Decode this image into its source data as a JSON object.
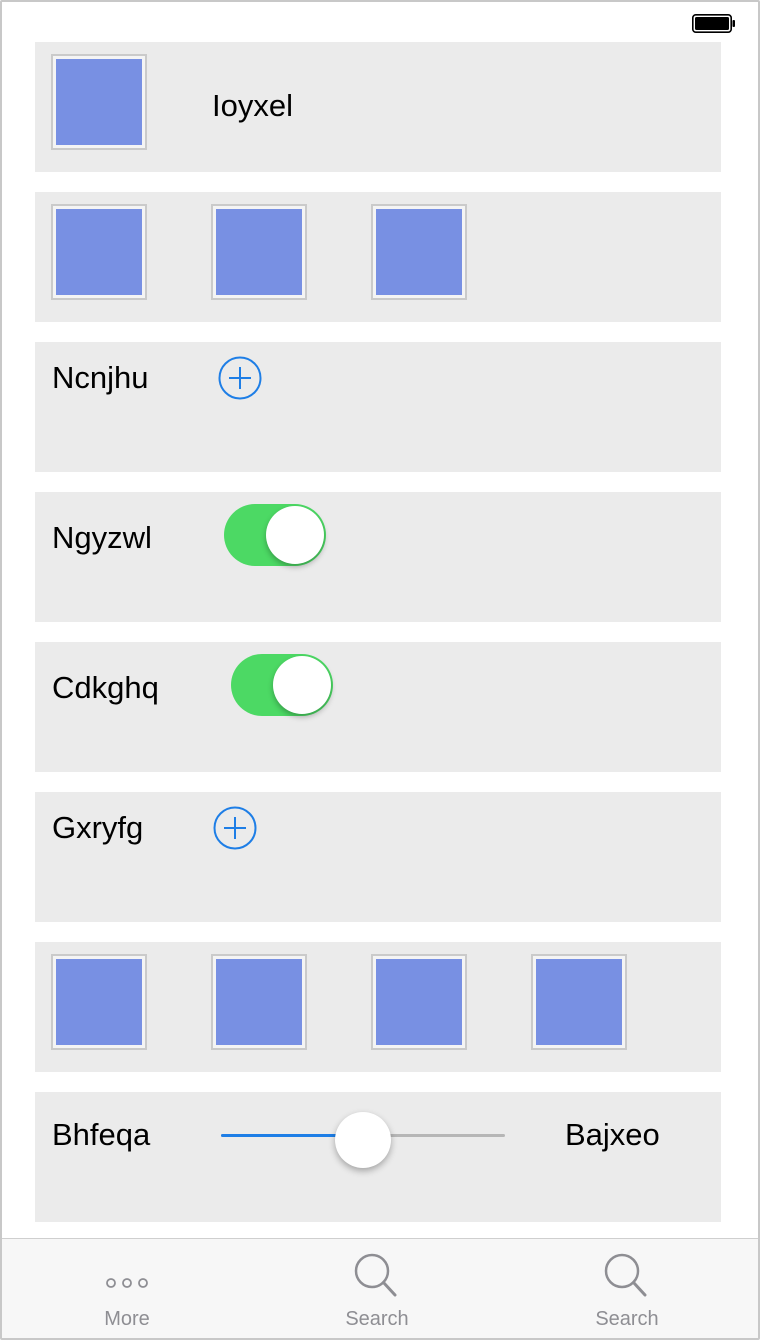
{
  "status_bar": {
    "battery": "full"
  },
  "rows": {
    "row1": {
      "label": "Ioyxel"
    },
    "row3": {
      "label": "Ncnjhu"
    },
    "row4": {
      "label": "Ngyzwl",
      "toggle_on": true
    },
    "row5": {
      "label": "Cdkghq",
      "toggle_on": true
    },
    "row6": {
      "label": "Gxryfg"
    },
    "row8": {
      "min_label": "Bhfeqa",
      "max_label": "Bajxeo",
      "value_fraction": 0.5
    }
  },
  "tabbar": {
    "tabs": [
      {
        "label": "More",
        "icon": "more-dots-icon"
      },
      {
        "label": "Search",
        "icon": "search-icon"
      },
      {
        "label": "Search",
        "icon": "search-icon"
      }
    ]
  },
  "colors": {
    "image_placeholder": "#7890e3",
    "toggle_on": "#4cd964",
    "accent_blue": "#1e7ee6",
    "row_background": "#ebebeb"
  }
}
